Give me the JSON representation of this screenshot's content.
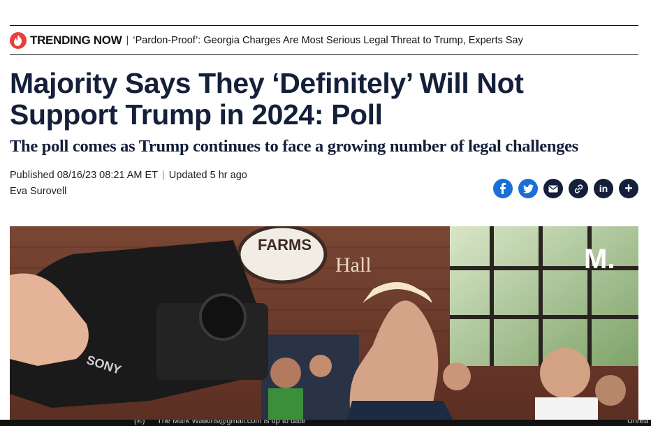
{
  "trending": {
    "label": "TRENDING NOW",
    "separator": "|",
    "headline": "‘Pardon-Proof’: Georgia Charges Are Most Serious Legal Threat to Trump, Experts Say"
  },
  "article": {
    "title": "Majority Says They ‘Definitely’ Will Not Support Trump in 2024: Poll",
    "subtitle": "The poll comes as Trump continues to face a growing number of legal challenges",
    "published": "Published 08/16/23 08:21 AM ET",
    "updated": "Updated 5 hr ago",
    "author": "Eva Surovell"
  },
  "share": {
    "icons": [
      "facebook-icon",
      "twitter-icon",
      "email-icon",
      "link-icon",
      "linkedin-icon",
      "more-icon"
    ]
  },
  "media": {
    "brand_mark": "M.",
    "camera_brand": "SONY",
    "sign_text": "FARMS",
    "hall_text": "Hall"
  },
  "caption": {
    "left": "(®)",
    "text": "The Mark Watkins@gmail.com is up to date",
    "right": "Unrea"
  },
  "colors": {
    "headline": "#14203a",
    "trending_flame": "#e8403a",
    "share_blue": "#1a6fd6",
    "share_dark": "#14203a"
  }
}
